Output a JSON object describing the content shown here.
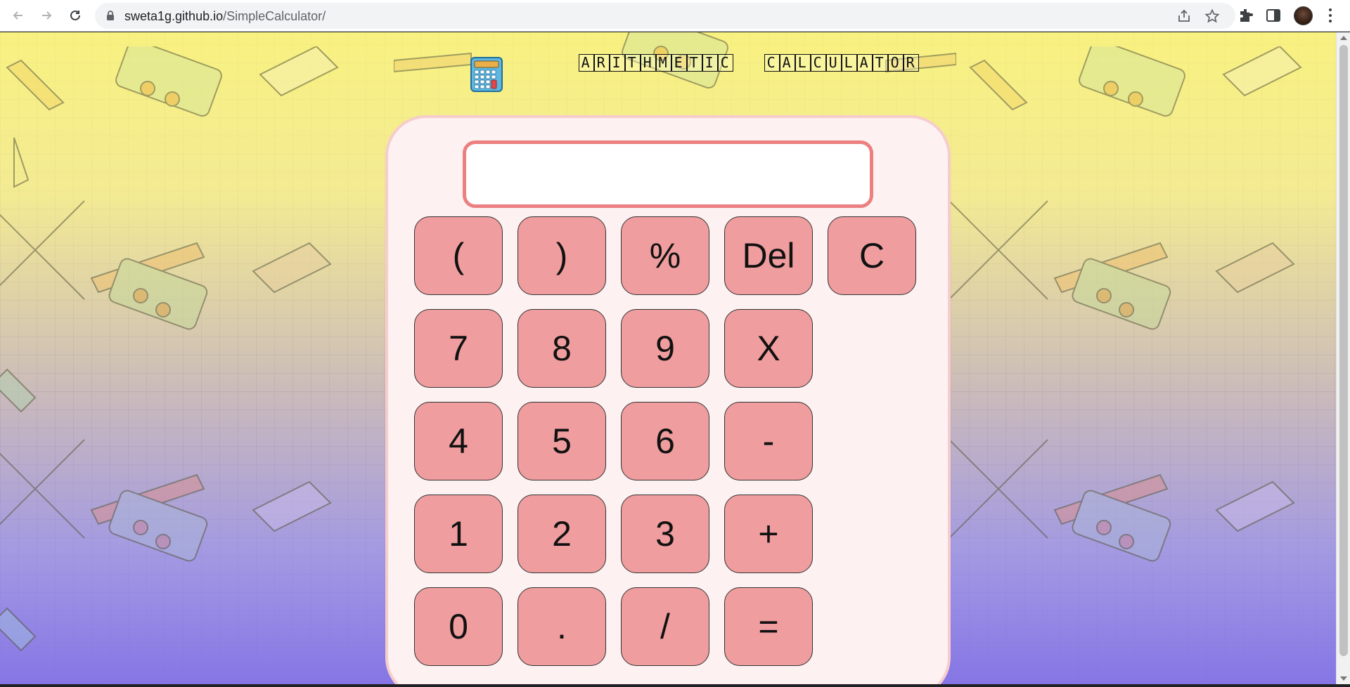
{
  "browser": {
    "url_host": "sweta1g.github.io",
    "url_path": "/SimpleCalculator/",
    "nav": [
      "back-icon",
      "forward-icon",
      "reload-icon"
    ],
    "omnibox_icons": [
      "share-icon",
      "bookmark-star-icon"
    ],
    "toolbar_icons": [
      "extensions-icon",
      "side-panel-icon",
      "profile-avatar",
      "more-menu-icon"
    ]
  },
  "page": {
    "title_words": [
      "ARITHMETIC",
      "CALCULATOR"
    ],
    "emoji_icon": "abacus-calculator-icon",
    "background_colors": {
      "top": "#fbf478",
      "bottom": "#8070e8"
    }
  },
  "calculator": {
    "display_value": "",
    "colors": {
      "body": "#fdf1f1",
      "display_border": "#ec7f80",
      "key": "#ef9d9e"
    },
    "rows": [
      [
        "(",
        ")",
        "%",
        "Del",
        "C"
      ],
      [
        "7",
        "8",
        "9",
        "X"
      ],
      [
        "4",
        "5",
        "6",
        "-"
      ],
      [
        "1",
        "2",
        "3",
        "+"
      ],
      [
        "0",
        ".",
        "/",
        "="
      ]
    ]
  }
}
